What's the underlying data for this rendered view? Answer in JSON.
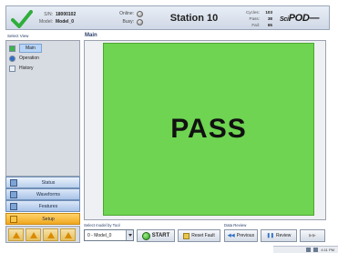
{
  "header": {
    "serial_label": "S/N:",
    "serial_value": "18000102",
    "model_label": "Model:",
    "model_value": "Model_0",
    "online_label": "Online:",
    "busy_label": "Busy:",
    "station_title": "Station 10",
    "cycles_label": "Cycles:",
    "cycles_value": "103",
    "pass_label": "Pass:",
    "pass_value": "38",
    "fail_label": "Fail:",
    "fail_value": "65",
    "logo_prefix": "Sci",
    "logo_main": "POD"
  },
  "left_panel": {
    "select_view_label": "Select View",
    "tree": [
      {
        "label": "Main",
        "icon": "main-icon",
        "selected": true
      },
      {
        "label": "Operation",
        "icon": "operation-icon",
        "selected": false
      },
      {
        "label": "History",
        "icon": "history-icon",
        "selected": false
      }
    ],
    "nav": [
      {
        "label": "Status",
        "icon": "status-icon"
      },
      {
        "label": "Waveforms",
        "icon": "waveforms-icon"
      },
      {
        "label": "Features",
        "icon": "features-icon"
      },
      {
        "label": "Setup",
        "icon": "setup-icon"
      }
    ]
  },
  "main": {
    "label": "Main",
    "result_text": "PASS",
    "result_color": "#6ed451"
  },
  "controls": {
    "select_model_label": "Select model by Tool",
    "model_selected": "0 - Model_0",
    "start_label": "START",
    "reset_label": "Reset Fault",
    "data_review_label": "Data Review",
    "previous_label": "Previous",
    "review_label": "Review",
    "next_label": ""
  },
  "taskbar": {
    "time": "4:11 PM"
  }
}
